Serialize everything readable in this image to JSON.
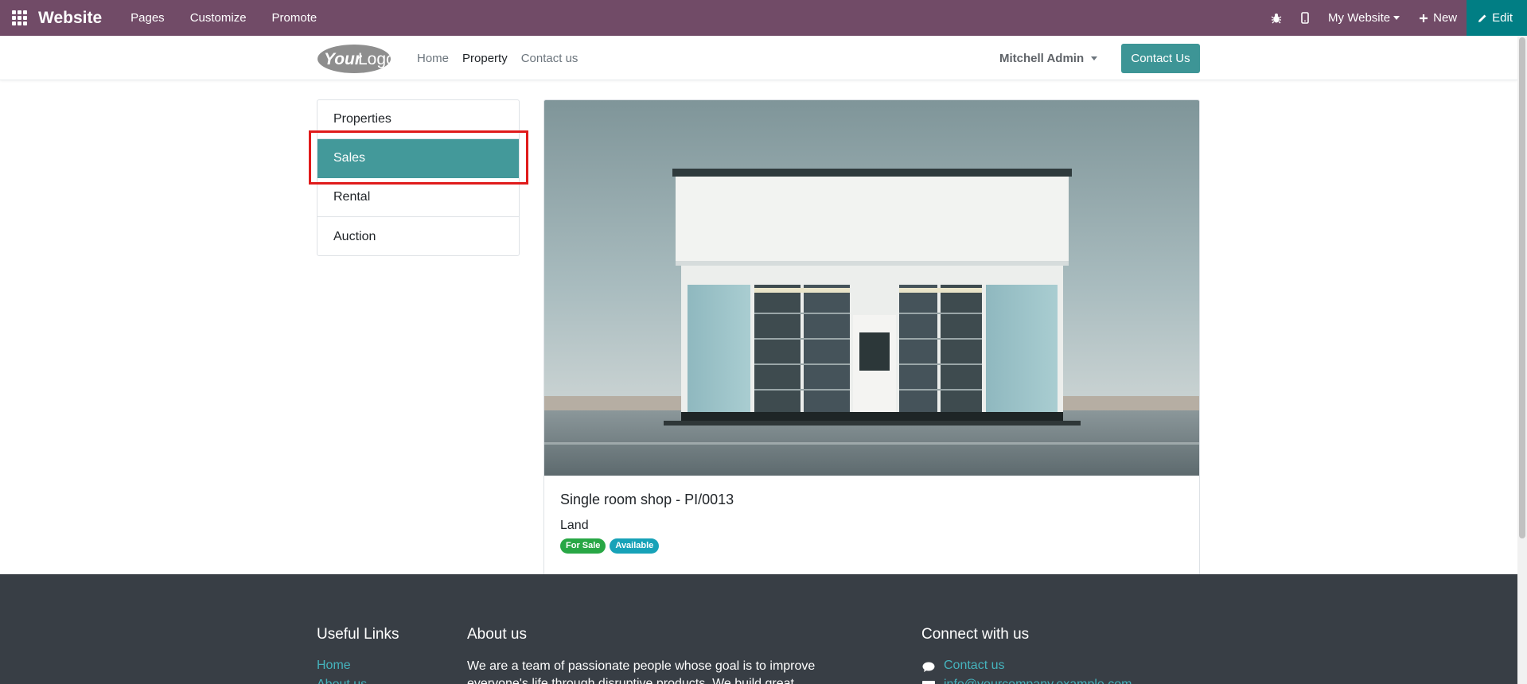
{
  "admin_bar": {
    "brand": "Website",
    "menu": [
      "Pages",
      "Customize",
      "Promote"
    ],
    "website_selector": "My Website",
    "new_label": "New",
    "edit_label": "Edit"
  },
  "header": {
    "logo_text": "YourLogo",
    "nav": [
      "Home",
      "Property",
      "Contact us"
    ],
    "active_nav": "Property",
    "user": "Mitchell Admin",
    "contact_button": "Contact Us"
  },
  "sidebar": {
    "items": [
      {
        "label": "Properties"
      },
      {
        "label": "Sales",
        "active": true
      },
      {
        "label": "Rental"
      },
      {
        "label": "Auction"
      }
    ]
  },
  "property": {
    "title": "Single room shop - PI/0013",
    "type": "Land",
    "badges": [
      "For Sale",
      "Available"
    ]
  },
  "footer": {
    "useful_links_title": "Useful Links",
    "useful_links": [
      "Home",
      "About us"
    ],
    "about_title": "About us",
    "about_text_line1": "We are a team of passionate people whose goal is to improve",
    "about_text_line2": "everyone's life through disruptive products. We build great",
    "connect_title": "Connect with us",
    "contact_link": "Contact us",
    "email_link": "info@yourcompany.example.com"
  },
  "colors": {
    "admin_bar": "#714b67",
    "edit_button": "#017e84",
    "primary": "#43999a",
    "footer": "#383e45",
    "highlight": "#e01b1b"
  }
}
